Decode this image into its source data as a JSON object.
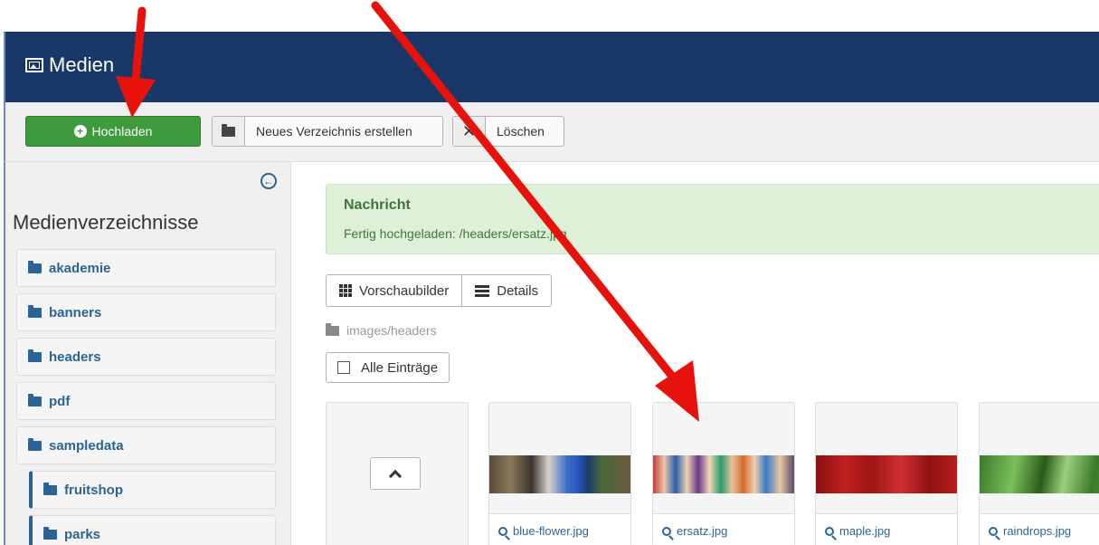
{
  "header": {
    "title": "Medien",
    "icon": "image-icon"
  },
  "toolbar": {
    "upload_label": "Hochladen",
    "newdir_label": "Neues Verzeichnis erstellen",
    "delete_label": "Löschen"
  },
  "sidebar": {
    "title": "Medienverzeichnisse",
    "folders": [
      {
        "label": "akademie"
      },
      {
        "label": "banners"
      },
      {
        "label": "headers"
      },
      {
        "label": "pdf"
      },
      {
        "label": "sampledata"
      },
      {
        "label": "fruitshop"
      },
      {
        "label": "parks"
      }
    ]
  },
  "message": {
    "heading": "Nachricht",
    "text": "Fertig hochgeladen: /headers/ersatz.jpg"
  },
  "views": {
    "thumbnails_label": "Vorschaubilder",
    "details_label": "Details"
  },
  "path": "images/headers",
  "select_all_label": "Alle Einträge",
  "files": [
    {
      "name": "blue-flower.jpg"
    },
    {
      "name": "ersatz.jpg"
    },
    {
      "name": "maple.jpg"
    },
    {
      "name": "raindrops.jpg"
    }
  ],
  "colors": {
    "header_bg": "#1a3867",
    "upload_green": "#3d9b3d",
    "alert_bg": "#dff0d8",
    "alert_text": "#3c763d",
    "link_blue": "#2a6496",
    "annotation_arrow": "#e8120c"
  }
}
